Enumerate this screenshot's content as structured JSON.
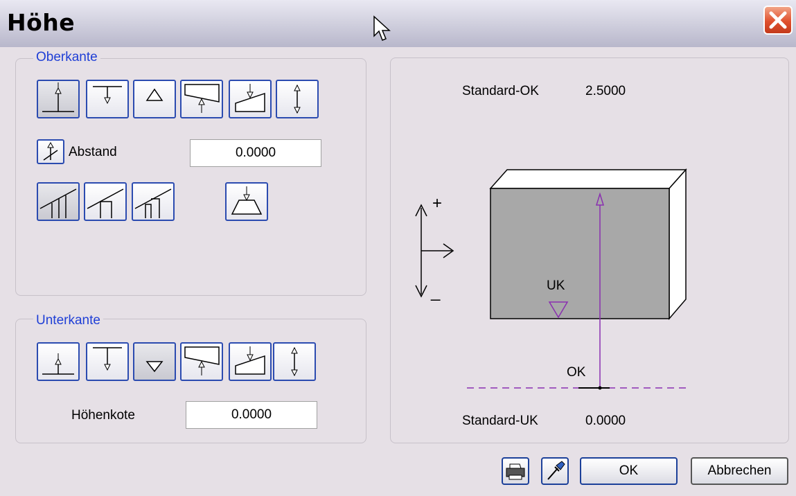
{
  "window": {
    "title": "Höhe"
  },
  "oberkante": {
    "legend": "Oberkante",
    "abstand_label": "Abstand",
    "abstand_value": "0.0000"
  },
  "unterkante": {
    "legend": "Unterkante",
    "hoehenkote_label": "Höhenkote",
    "hoehenkote_value": "0.0000"
  },
  "preview": {
    "standard_ok_label": "Standard-OK",
    "standard_ok_value": "2.5000",
    "standard_uk_label": "Standard-UK",
    "standard_uk_value": "0.0000",
    "uk_label": "UK",
    "ok_label": "OK",
    "plus_sign": "+",
    "minus_sign": "_"
  },
  "footer": {
    "ok_label": "OK",
    "cancel_label": "Abbrechen"
  },
  "colors": {
    "accent": "#1f3fd6",
    "guide": "#8a2fb0",
    "body_fill": "#a8a8a8"
  }
}
